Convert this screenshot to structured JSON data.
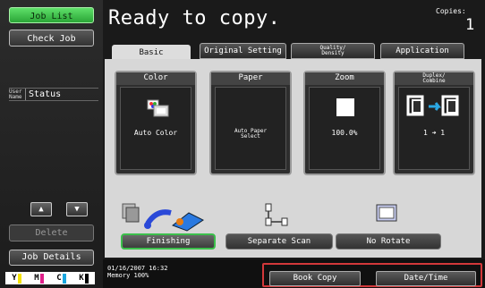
{
  "left_panel": {
    "job_list": "Job List",
    "check_job": "Check Job",
    "user_name": "User Name",
    "status": "Status",
    "delete": "Delete",
    "job_details": "Job Details",
    "toner": [
      "Y",
      "M",
      "C",
      "K"
    ]
  },
  "header": {
    "title": "Ready to copy.",
    "copies_label": "Copies:",
    "copies_value": "1"
  },
  "tabs": {
    "basic": "Basic",
    "original_setting": "Original Setting",
    "quality_density": "Quality/ Density",
    "application": "Application"
  },
  "cards": {
    "color": {
      "title": "Color",
      "value": "Auto Color"
    },
    "paper": {
      "title": "Paper",
      "value": "Auto Paper Select"
    },
    "zoom": {
      "title": "Zoom",
      "value": "100.0%"
    },
    "duplex": {
      "title": "Duplex/ Combine",
      "value": "1 ➜ 1"
    }
  },
  "functions": {
    "finishing": "Finishing",
    "separate_scan": "Separate Scan",
    "no_rotate": "No Rotate"
  },
  "status_bar": {
    "date_time": "01/16/2007   16:32",
    "memory": "Memory         100%",
    "book_copy": "Book Copy",
    "date_time_btn": "Date/Time"
  },
  "colors": {
    "green_button": "#3fc64c",
    "highlight_red": "#d2383a",
    "panel_gray": "#d7d7d7"
  }
}
